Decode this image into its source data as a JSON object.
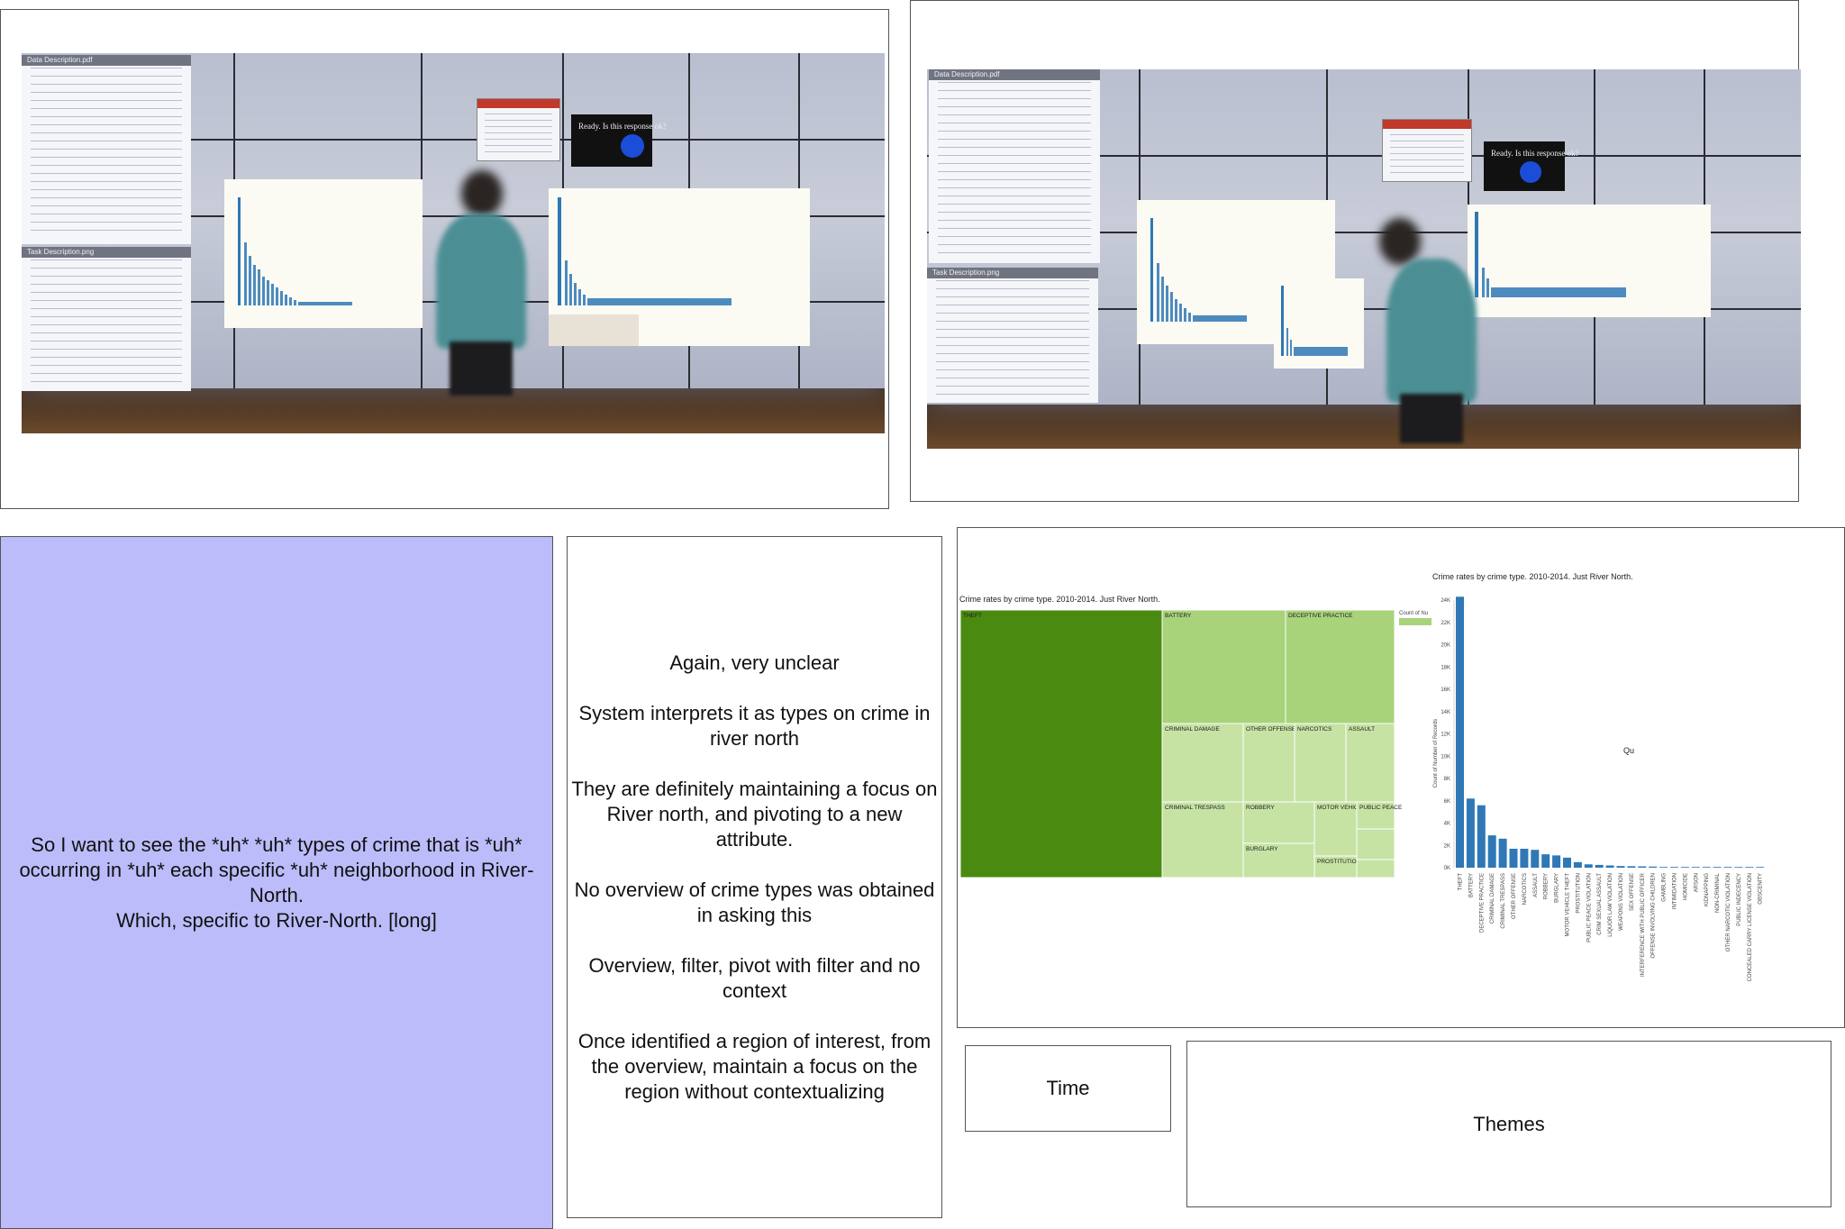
{
  "photos": {
    "left": {
      "doc_title": "Task Description.png",
      "top_doc_title": "Data Description.pdf",
      "card_text": "Ready. Is this response ok?"
    },
    "right": {
      "doc_title": "Task Description.png",
      "top_doc_title": "Data Description.pdf",
      "card_text": "Ready. Is this response ok?"
    }
  },
  "speech": {
    "lines": [
      "So I want to see the *uh* *uh* types of crime that is *uh* occurring in *uh* each specific *uh* neighborhood in River-North.",
      "Which, specific to River-North. [long]"
    ],
    "bg_color": "#bcbcfb"
  },
  "notes": [
    "Again, very unclear",
    "System interprets it as types on crime in river north",
    "They are definitely maintaining a focus on River north, and pivoting to a new attribute.",
    "No overview of crime types was obtained in asking this",
    "Overview, filter, pivot with filter and no context",
    "Once identified a region of interest, from the overview, maintain a focus on the region without contextualizing"
  ],
  "labels": {
    "time": "Time",
    "themes": "Themes"
  },
  "chart_data": [
    {
      "type": "treemap",
      "title": "Crime rates by crime type. 2010-2014.  Just River North.",
      "legend_title": "Count of Nu",
      "colors": [
        "#4a8a10",
        "#a9d37b",
        "#c6e3a4"
      ],
      "cells": [
        {
          "label": "THEFT",
          "shade": 0
        },
        {
          "label": "BATTERY",
          "shade": 1
        },
        {
          "label": "DECEPTIVE PRACTICE",
          "shade": 1
        },
        {
          "label": "CRIMINAL DAMAGE",
          "shade": 2
        },
        {
          "label": "OTHER OFFENSE",
          "shade": 2
        },
        {
          "label": "NARCOTICS",
          "shade": 2
        },
        {
          "label": "ASSAULT",
          "shade": 2
        },
        {
          "label": "CRIMINAL TRESPASS",
          "shade": 2
        },
        {
          "label": "ROBBERY",
          "shade": 2
        },
        {
          "label": "MOTOR VEHICLE THEFT",
          "shade": 2
        },
        {
          "label": "PUBLIC PEACE",
          "shade": 2
        },
        {
          "label": "BURGLARY",
          "shade": 2
        },
        {
          "label": "PROSTITUTION",
          "shade": 2
        },
        {
          "label": "",
          "shade": 2
        },
        {
          "label": "",
          "shade": 2
        }
      ]
    },
    {
      "type": "bar",
      "title": "Crime rates by crime type. 2010-2014.  Just River North.",
      "ylabel": "Count of Number of Records",
      "annotation": "Qu",
      "color": "#2f78b5",
      "ylim": [
        0,
        24000
      ],
      "yticks": [
        "0K",
        "2K",
        "4K",
        "6K",
        "8K",
        "10K",
        "12K",
        "14K",
        "16K",
        "18K",
        "20K",
        "22K",
        "24K"
      ],
      "categories": [
        "THEFT",
        "BATTERY",
        "DECEPTIVE PRACTICE",
        "CRIMINAL DAMAGE",
        "CRIMINAL TRESPASS",
        "OTHER OFFENSE",
        "NARCOTICS",
        "ASSAULT",
        "ROBBERY",
        "BURGLARY",
        "MOTOR VEHICLE THEFT",
        "PROSTITUTION",
        "PUBLIC PEACE VIOLATION",
        "CRIM SEXUAL ASSAULT",
        "LIQUOR LAW VIOLATION",
        "WEAPONS VIOLATION",
        "SEX OFFENSE",
        "INTERFERENCE WITH PUBLIC OFFICER",
        "OFFENSE INVOLVING CHILDREN",
        "GAMBLING",
        "INTIMIDATION",
        "HOMICIDE",
        "ARSON",
        "KIDNAPPING",
        "NON-CRIMINAL",
        "OTHER NARCOTIC VIOLATION",
        "PUBLIC INDECENCY",
        "CONCEALED CARRY LICENSE VIOLATION",
        "OBSCENITY"
      ],
      "values": [
        24300,
        6200,
        5600,
        2900,
        2600,
        1700,
        1700,
        1600,
        1200,
        1100,
        900,
        500,
        300,
        250,
        200,
        150,
        130,
        120,
        100,
        20,
        20,
        15,
        12,
        10,
        8,
        6,
        5,
        4,
        3
      ]
    }
  ]
}
